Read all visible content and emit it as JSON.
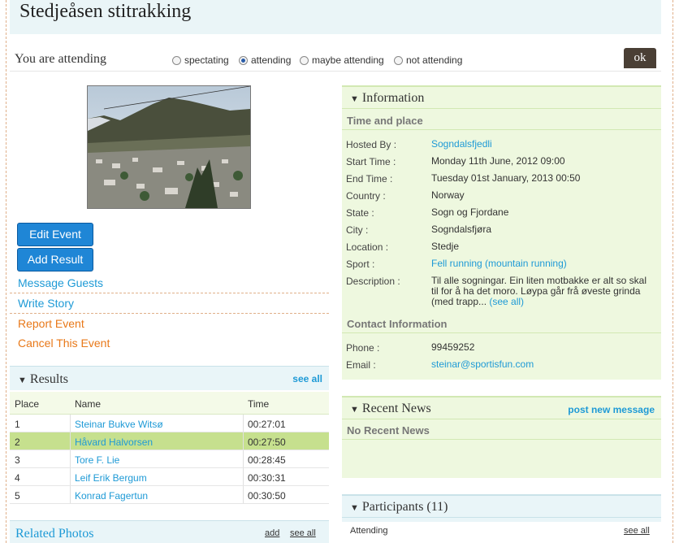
{
  "event": {
    "title": "Stedjeåsen stitrakking"
  },
  "attendance": {
    "label": "You are attending",
    "options": [
      {
        "label": "spectating",
        "selected": false
      },
      {
        "label": "attending",
        "selected": true
      },
      {
        "label": "maybe attending",
        "selected": false
      },
      {
        "label": "not attending",
        "selected": false
      }
    ],
    "ok_label": "ok"
  },
  "actions": {
    "edit_event": "Edit Event",
    "add_result": "Add Result",
    "message_guests": "Message Guests",
    "write_story": "Write Story",
    "report_event": "Report Event",
    "cancel_event": "Cancel This Event"
  },
  "results": {
    "title": "Results",
    "see_all": "see all",
    "columns": [
      "Place",
      "Name",
      "Time"
    ],
    "rows": [
      {
        "place": "1",
        "name": "Steinar Bukve Witsø",
        "time": "00:27:01",
        "highlight": false
      },
      {
        "place": "2",
        "name": "Håvard Halvorsen",
        "time": "00:27:50",
        "highlight": true
      },
      {
        "place": "3",
        "name": "Tore F. Lie",
        "time": "00:28:45",
        "highlight": false
      },
      {
        "place": "4",
        "name": "Leif Erik Bergum",
        "time": "00:30:31",
        "highlight": false
      },
      {
        "place": "5",
        "name": "Konrad Fagertun",
        "time": "00:30:50",
        "highlight": false
      }
    ]
  },
  "related_photos": {
    "title": "Related Photos",
    "add": "add",
    "see_all": "see all"
  },
  "information": {
    "title": "Information",
    "time_place_header": "Time and place",
    "hosted_by": {
      "label": "Hosted By :",
      "value": "Sogndalsfjedli"
    },
    "start_time": {
      "label": "Start Time :",
      "value": "Monday 11th June, 2012 09:00"
    },
    "end_time": {
      "label": "End Time :",
      "value": "Tuesday 01st January, 2013 00:50"
    },
    "country": {
      "label": "Country :",
      "value": "Norway"
    },
    "state": {
      "label": "State :",
      "value": "Sogn og Fjordane"
    },
    "city": {
      "label": "City :",
      "value": "Sogndalsfjøra"
    },
    "location": {
      "label": "Location :",
      "value": "Stedje"
    },
    "sport": {
      "label": "Sport :",
      "value": "Fell running (mountain running)"
    },
    "description": {
      "label": "Description :",
      "value": "Til alle sogningar. Ein liten motbakke er alt so skal til for å ha det moro. Løypa går frå øveste grinda (med trapp...",
      "see_all": "(see all)"
    },
    "contact_header": "Contact Information",
    "phone": {
      "label": "Phone :",
      "value": "99459252"
    },
    "email": {
      "label": "Email :",
      "value": "steinar@sportisfun.com"
    }
  },
  "recent_news": {
    "title": "Recent News",
    "post_label": "post new message",
    "empty": "No Recent News"
  },
  "participants": {
    "title": "Participants (11)",
    "attending_label": "Attending",
    "see_all": "see all"
  }
}
